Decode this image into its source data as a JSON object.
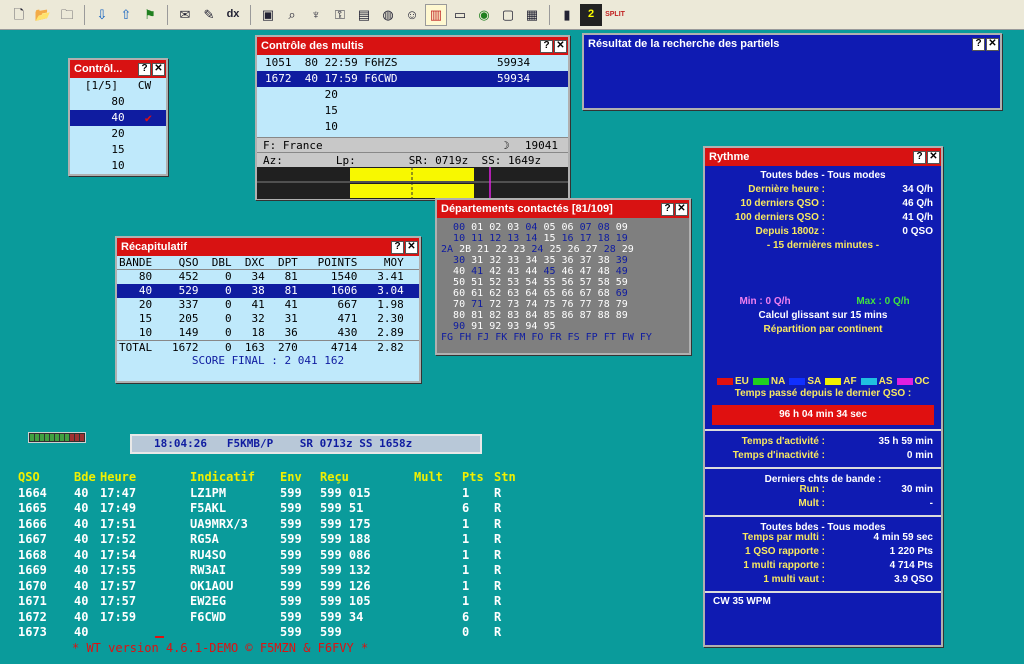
{
  "toolbar": {
    "icons": [
      "new-icon",
      "open-icon",
      "save-icon",
      "arrow-down-icon",
      "arrow-up-icon",
      "flag-icon",
      "envelope-icon",
      "notepad-icon",
      "dx-icon",
      "zoom-page-icon",
      "magnify-icon",
      "microphone-icon",
      "key-icon",
      "computer-icon",
      "globe-icon",
      "chart-icon",
      "card-icon",
      "earth-icon",
      "window-icon",
      "monitor-icon",
      "book-icon",
      "two-icon",
      "split-icon"
    ],
    "dx_label": "dx",
    "split_label": "SPLIT",
    "two_label": "2"
  },
  "ctrl_small": {
    "title": "Contrôl...",
    "header": "[1/5]   CW",
    "bands": [
      "80",
      "40",
      "20",
      "15",
      "10"
    ],
    "selected": "40",
    "check": "✔"
  },
  "multis": {
    "title": "Contrôle des multis",
    "rows": [
      {
        "text": "1051  80 22:59 F6HZS",
        "score": "59934"
      },
      {
        "text": "1672  40 17:59 F6CWD",
        "score": "59934"
      },
      {
        "text": "         20",
        "score": ""
      },
      {
        "text": "         15",
        "score": ""
      },
      {
        "text": "         10",
        "score": ""
      }
    ],
    "country": "F: France",
    "moon": "☽",
    "country_num": "19041",
    "az_line": "Az:        Lp:        SR: 0719z  SS: 1649z"
  },
  "result": {
    "title": "Résultat de la recherche des partiels"
  },
  "dept": {
    "title": "Départements contactés [81/109]",
    "rows": [
      [
        [
          "  00 01 02 03 ",
          ""
        ],
        [
          "04 ",
          "w"
        ],
        [
          "05 06 ",
          ""
        ],
        [
          "07 08 09",
          ""
        ]
      ],
      [
        [
          "  10 11 12 13 14 ",
          ""
        ],
        [
          "15 16 17 18 19",
          ""
        ]
      ],
      [
        [
          "2A 2B 21 22 23 24 25 26 27 28 29",
          ""
        ]
      ],
      [
        [
          "  30 31 32 33 34 35 36 37 38 39",
          ""
        ]
      ],
      [
        [
          "  40 41 ",
          ""
        ],
        [
          "42 43 ",
          ""
        ],
        [
          "44 45 46 47 ",
          ""
        ],
        [
          "48 49",
          ""
        ]
      ],
      [
        [
          "  50 51 52 53 54 55 56 57 58 59",
          ""
        ]
      ],
      [
        [
          "  60 61 62 63 64 65 66 67 68 69",
          ""
        ]
      ],
      [
        [
          "  70 71 72 73 74 75 76 77 78 79",
          ""
        ]
      ],
      [
        [
          "  80 81 82 83 84 85 86 87 88 89",
          ""
        ]
      ],
      [
        [
          "  90 91 92 93 94 95",
          ""
        ]
      ],
      [
        [
          "FG FH FJ FK FM FO FR FS FP FT FW FY",
          ""
        ]
      ]
    ],
    "white_cells": [
      "01",
      "02",
      "03",
      "05",
      "06",
      "09",
      "15",
      "2B",
      "21",
      "22",
      "23",
      "25",
      "26",
      "27",
      "29",
      "31",
      "32",
      "33",
      "34",
      "35",
      "36",
      "37",
      "38",
      "40",
      "42",
      "43",
      "44",
      "46",
      "47",
      "48",
      "50",
      "51",
      "52",
      "53",
      "54",
      "55",
      "56",
      "57",
      "58",
      "59",
      "60",
      "61",
      "62",
      "63",
      "64",
      "65",
      "66",
      "67",
      "68",
      "70",
      "72",
      "73",
      "74",
      "75",
      "76",
      "77",
      "78",
      "79",
      "80",
      "81",
      "82",
      "83",
      "84",
      "85",
      "86",
      "87",
      "88",
      "89",
      "91",
      "92",
      "93",
      "94",
      "95"
    ]
  },
  "recap": {
    "title": "Récapitulatif",
    "header": "BANDE    QSO  DBL  DXC  DPT   POINTS    MOY",
    "rows": [
      "   80    452    0   34   81     1540   3.41",
      "   40    529    0   38   81     1606   3.04",
      "   20    337    0   41   41      667   1.98",
      "   15    205    0   32   31      471   2.30",
      "   10    149    0   18   36      430   2.89"
    ],
    "selected_index": 1,
    "total": "TOTAL   1672    0  163  270     4714   2.82",
    "score": "SCORE FINAL : 2 041 162"
  },
  "status": {
    "text": "18:04:26   F5KMB/P    SR 0713z SS 1658z"
  },
  "log": {
    "headers": [
      "QSO",
      "Bde",
      "Heure",
      "Indicatif",
      "Env",
      "Reçu",
      "Mult",
      "Pts",
      "Stn"
    ],
    "rows": [
      [
        "1664",
        "40",
        "17:47",
        "LZ1PM",
        "599",
        "599 015",
        "",
        "1",
        "R"
      ],
      [
        "1665",
        "40",
        "17:49",
        "F5AKL",
        "599",
        "599 51",
        "",
        "6",
        "R"
      ],
      [
        "1666",
        "40",
        "17:51",
        "UA9MRX/3",
        "599",
        "599 175",
        "",
        "1",
        "R"
      ],
      [
        "1667",
        "40",
        "17:52",
        "RG5A",
        "599",
        "599 188",
        "",
        "1",
        "R"
      ],
      [
        "1668",
        "40",
        "17:54",
        "RU4SO",
        "599",
        "599 086",
        "",
        "1",
        "R"
      ],
      [
        "1669",
        "40",
        "17:55",
        "RW3AI",
        "599",
        "599 132",
        "",
        "1",
        "R"
      ],
      [
        "1670",
        "40",
        "17:57",
        "OK1AOU",
        "599",
        "599 126",
        "",
        "1",
        "R"
      ],
      [
        "1671",
        "40",
        "17:57",
        "EW2EG",
        "599",
        "599 105",
        "",
        "1",
        "R"
      ],
      [
        "1672",
        "40",
        "17:59",
        "F6CWD",
        "599",
        "599 34",
        "",
        "6",
        "R"
      ],
      [
        "1673",
        "40",
        "",
        "",
        "599",
        "599",
        "",
        "0",
        "R"
      ]
    ],
    "footer": "* WT version 4.6.1-DEMO © F5MZN & F6FVY *"
  },
  "rythme": {
    "title": "Rythme",
    "section1_title": "Toutes bdes - Tous modes",
    "rates": [
      {
        "label": "Dernière heure :",
        "value": "34 Q/h"
      },
      {
        "label": "10 derniers QSO :",
        "value": "46 Q/h"
      },
      {
        "label": "100 derniers QSO :",
        "value": "41 Q/h"
      },
      {
        "label": "Depuis 1800z :",
        "value": "0 QSO"
      }
    ],
    "last15": "- 15 dernières minutes -",
    "min": "Min : 0 Q/h",
    "max": "Max : 0 Q/h",
    "glissant": "Calcul glissant sur 15 mins",
    "repartition": "Répartition par continent",
    "legend": [
      {
        "label": "EU",
        "color": "#e01010"
      },
      {
        "label": "NA",
        "color": "#20d020"
      },
      {
        "label": "SA",
        "color": "#1030ff"
      },
      {
        "label": "AF",
        "color": "#f0f000"
      },
      {
        "label": "AS",
        "color": "#20c0e0"
      },
      {
        "label": "OC",
        "color": "#e020e0"
      }
    ],
    "since_last": "Temps passé depuis le dernier QSO :",
    "since_value": "96 h 04 min 34 sec",
    "activity": [
      {
        "label": "Temps d'activité :",
        "value": "35 h 59 min"
      },
      {
        "label": "Temps d'inactivité :",
        "value": "0 min"
      }
    ],
    "band_changes_title": "Derniers chts de bande :",
    "band_changes": [
      {
        "label": "Run :",
        "value": "30 min"
      },
      {
        "label": "Mult :",
        "value": "-"
      }
    ],
    "section4_title": "Toutes bdes - Tous modes",
    "stats": [
      {
        "label": "Temps par multi :",
        "value": "4 min 59 sec"
      },
      {
        "label": "1 QSO rapporte :",
        "value": "1 220 Pts"
      },
      {
        "label": "1 multi rapporte :",
        "value": "4 714 Pts"
      },
      {
        "label": "1 multi vaut :",
        "value": "3.9 QSO"
      }
    ],
    "footer": "CW  35 WPM"
  }
}
